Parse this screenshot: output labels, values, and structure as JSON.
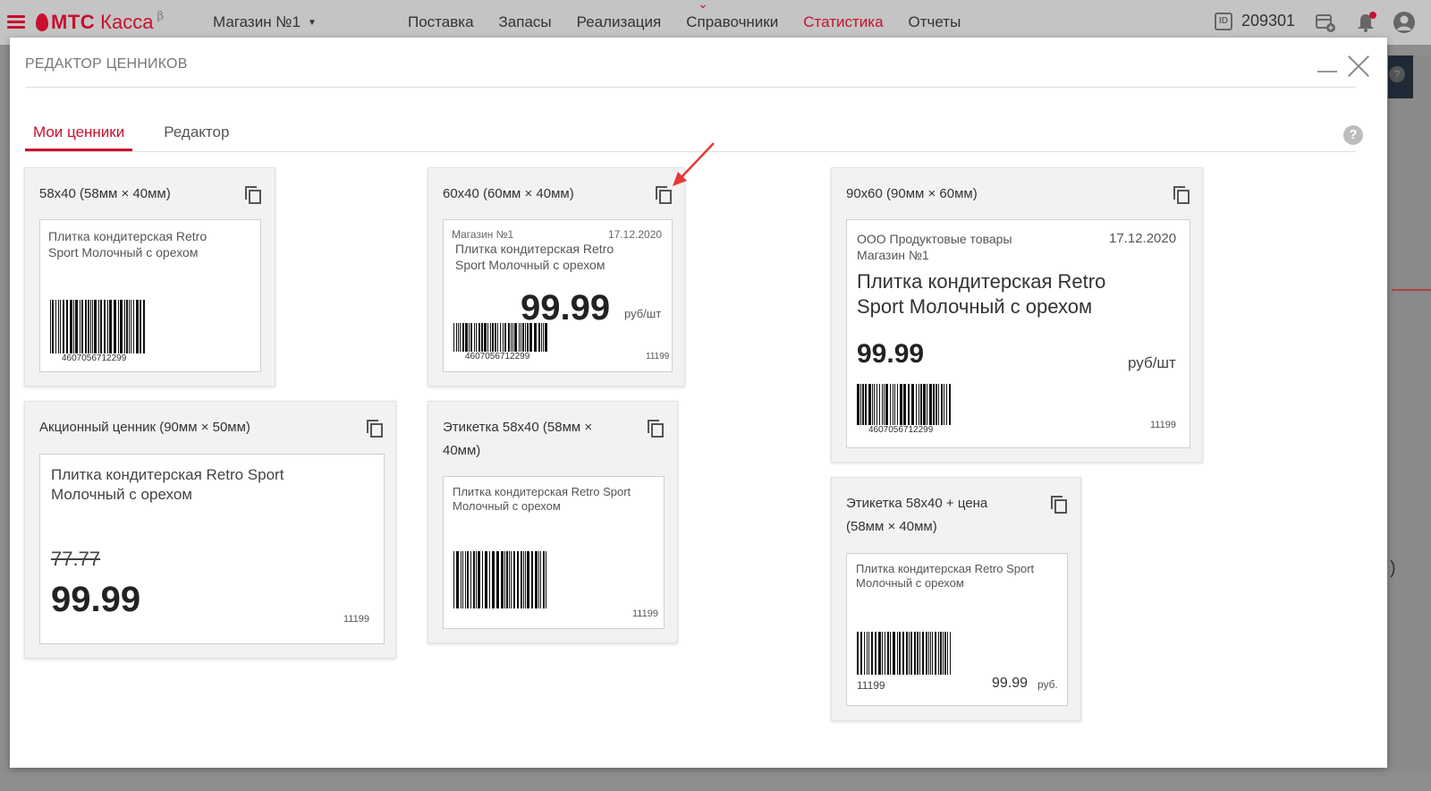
{
  "topbar": {
    "brand": "МТС",
    "product": "Касса",
    "beta": "β",
    "store": "Магазин №1",
    "nav": [
      {
        "label": "Поставка"
      },
      {
        "label": "Запасы"
      },
      {
        "label": "Реализация"
      },
      {
        "label": "Справочники"
      },
      {
        "label": "Статистика",
        "active": true
      },
      {
        "label": "Отчеты"
      }
    ],
    "id_label": "ID",
    "account_id": "209301"
  },
  "modal": {
    "title": "РЕДАКТОР ЦЕННИКОВ",
    "tabs": [
      {
        "label": "Мои ценники",
        "active": true
      },
      {
        "label": "Редактор",
        "active": false
      }
    ],
    "help": "?"
  },
  "templates": {
    "t1": {
      "title": "58x40 (58мм × 40мм)",
      "product": [
        "Плитка кондитерская Retro",
        "Sport Молочный с орехом"
      ],
      "barcode": "4607056712299"
    },
    "t2": {
      "title": "60x40 (60мм × 40мм)",
      "store": "Магазин №1",
      "date": "17.12.2020",
      "product": [
        "Плитка кондитерская Retro",
        "Sport Молочный с орехом"
      ],
      "price": "99.99",
      "unit": "руб/шт",
      "barcode": "4607056712299",
      "code": "11199"
    },
    "t3": {
      "title": "90x60 (90мм × 60мм)",
      "org": "ООО Продуктовые товары",
      "store": "Магазин №1",
      "date": "17.12.2020",
      "product": [
        "Плитка кондитерская Retro",
        "Sport Молочный с орехом"
      ],
      "price": "99.99",
      "unit": "руб/шт",
      "barcode": "4607056712299",
      "code": "11199"
    },
    "t4": {
      "title": "Акционный ценник (90мм × 50мм)",
      "product": [
        "Плитка кондитерская Retro Sport",
        "Молочный с орехом"
      ],
      "old_price": "77.77",
      "price": "99.99",
      "code": "11199"
    },
    "t5": {
      "title": [
        "Этикетка 58x40 (58мм ×",
        "40мм)"
      ],
      "product": [
        "Плитка кондитерская Retro Sport",
        "Молочный с орехом"
      ],
      "code": "11199"
    },
    "t6": {
      "title": [
        "Этикетка 58x40 + цена",
        "(58мм × 40мм)"
      ],
      "product": [
        "Плитка кондитерская Retro Sport",
        "Молочный с орехом"
      ],
      "code": "11199",
      "price": "99.99",
      "currency": "руб."
    }
  },
  "colors": {
    "accent": "#c8102e",
    "annotation_arrow": "#e53935"
  }
}
